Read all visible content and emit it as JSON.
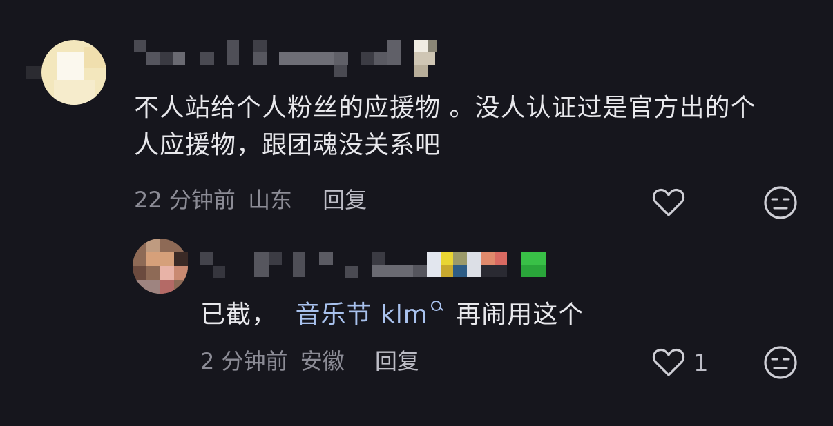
{
  "comments": [
    {
      "text": "不人站给个人粉丝的应援物 。没人认证过是官方出的个人应援物，跟团魂没关系吧",
      "time": "22 分钟前",
      "location": "山东",
      "reply_label": "回复",
      "like_icon": "heart-icon",
      "dislike_icon": "meh-face-icon"
    },
    {
      "text_prefix": "已截，",
      "link_text": "音乐节 klm",
      "text_suffix": "再闹用这个",
      "time": "2 分钟前",
      "location": "安徽",
      "reply_label": "回复",
      "like_count": "1",
      "like_icon": "heart-icon",
      "dislike_icon": "meh-face-icon"
    }
  ]
}
